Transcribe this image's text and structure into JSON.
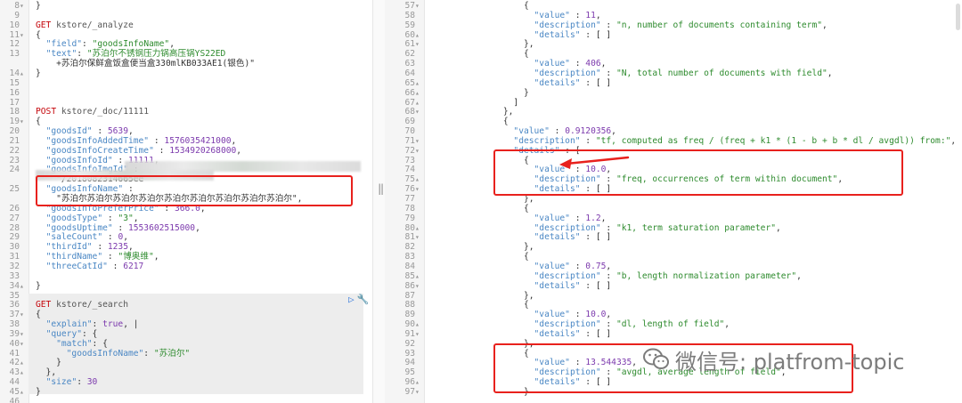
{
  "left_editor": {
    "lines": [
      {
        "n": "8",
        "fold": "▾",
        "text": "}"
      },
      {
        "n": "9",
        "fold": "",
        "text": ""
      },
      {
        "n": "10",
        "fold": "",
        "text": "GET kstore/_analyze"
      },
      {
        "n": "11",
        "fold": "▾",
        "text": "{"
      },
      {
        "n": "12",
        "fold": "",
        "text": "  \"field\": \"goodsInfoName\","
      },
      {
        "n": "13",
        "fold": "",
        "text": "  \"text\": \"苏泊尔不锈钢压力锅高压锅YS22ED"
      },
      {
        "n": "",
        "fold": "",
        "text": "    +苏泊尔保鲜盒饭盒便当盒330mlKB033AE1(银色)\""
      },
      {
        "n": "14",
        "fold": "▴",
        "text": "}"
      },
      {
        "n": "15",
        "fold": "",
        "text": ""
      },
      {
        "n": "16",
        "fold": "",
        "text": ""
      },
      {
        "n": "17",
        "fold": "",
        "text": ""
      },
      {
        "n": "18",
        "fold": "",
        "text": "POST kstore/_doc/11111"
      },
      {
        "n": "19",
        "fold": "▾",
        "text": "{"
      },
      {
        "n": "20",
        "fold": "",
        "text": "  \"goodsId\" : 5639,"
      },
      {
        "n": "21",
        "fold": "",
        "text": "  \"goodsInfoAddedTime\" : 1576035421000,"
      },
      {
        "n": "22",
        "fold": "",
        "text": "  \"goodsInfoCreateTime\" : 1534920268000,"
      },
      {
        "n": "23",
        "fold": "",
        "text": "  \"goodsInfoId\" : 11111,"
      },
      {
        "n": "24",
        "fold": "",
        "text": "  \"goodsInfoImgId\" :"
      },
      {
        "n": "",
        "fold": "",
        "text": "    \"/2018082314665ee"
      },
      {
        "n": "25",
        "fold": "",
        "text": "  \"goodsInfoName\" :"
      },
      {
        "n": "",
        "fold": "",
        "text": "    \"苏泊尔苏泊尔苏泊尔苏泊尔苏泊尔苏泊尔苏泊尔苏泊尔苏泊尔\","
      },
      {
        "n": "26",
        "fold": "",
        "text": "  \"goodsInfoPreferPrice\" : 366.0,"
      },
      {
        "n": "27",
        "fold": "",
        "text": "  \"goodsType\" : \"3\","
      },
      {
        "n": "28",
        "fold": "",
        "text": "  \"goodsUptime\" : 1553602515000,"
      },
      {
        "n": "29",
        "fold": "",
        "text": "  \"saleCount\" : 0,"
      },
      {
        "n": "30",
        "fold": "",
        "text": "  \"thirdId\" : 1235,"
      },
      {
        "n": "31",
        "fold": "",
        "text": "  \"thirdName\" : \"博奥维\","
      },
      {
        "n": "32",
        "fold": "",
        "text": "  \"threeCatId\" : 6217"
      },
      {
        "n": "33",
        "fold": "",
        "text": ""
      },
      {
        "n": "34",
        "fold": "▴",
        "text": "}"
      },
      {
        "n": "35",
        "fold": "",
        "text": ""
      },
      {
        "n": "36",
        "fold": "",
        "text": "GET kstore/_search"
      },
      {
        "n": "37",
        "fold": "▾",
        "text": "{"
      },
      {
        "n": "38",
        "fold": "",
        "text": "  \"explain\": true, |"
      },
      {
        "n": "39",
        "fold": "▾",
        "text": "  \"query\": {"
      },
      {
        "n": "40",
        "fold": "▾",
        "text": "    \"match\": {"
      },
      {
        "n": "41",
        "fold": "",
        "text": "      \"goodsInfoName\": \"苏泊尔\""
      },
      {
        "n": "42",
        "fold": "▴",
        "text": "    }"
      },
      {
        "n": "43",
        "fold": "▴",
        "text": "  },"
      },
      {
        "n": "44",
        "fold": "",
        "text": "  \"size\": 30"
      },
      {
        "n": "45",
        "fold": "▴",
        "text": "}"
      },
      {
        "n": "46",
        "fold": "",
        "text": ""
      }
    ]
  },
  "right_editor": {
    "lines": [
      {
        "n": "57",
        "fold": "▾",
        "text": "                  {"
      },
      {
        "n": "58",
        "fold": "",
        "text": "                    \"value\" : 11,"
      },
      {
        "n": "59",
        "fold": "",
        "text": "                    \"description\" : \"n, number of documents containing term\","
      },
      {
        "n": "60",
        "fold": "▴",
        "text": "                    \"details\" : [ ]"
      },
      {
        "n": "61",
        "fold": "▾",
        "text": "                  },"
      },
      {
        "n": "62",
        "fold": "",
        "text": "                  {"
      },
      {
        "n": "63",
        "fold": "",
        "text": "                    \"value\" : 406,"
      },
      {
        "n": "64",
        "fold": "",
        "text": "                    \"description\" : \"N, total number of documents with field\","
      },
      {
        "n": "65",
        "fold": "▴",
        "text": "                    \"details\" : [ ]"
      },
      {
        "n": "66",
        "fold": "▴",
        "text": "                  }"
      },
      {
        "n": "67",
        "fold": "▴",
        "text": "                ]"
      },
      {
        "n": "68",
        "fold": "▾",
        "text": "              },"
      },
      {
        "n": "69",
        "fold": "",
        "text": "              {"
      },
      {
        "n": "70",
        "fold": "",
        "text": "                \"value\" : 0.9120356,"
      },
      {
        "n": "71",
        "fold": "▾",
        "text": "                \"description\" : \"tf, computed as freq / (freq + k1 * (1 - b + b * dl / avgdl)) from:\","
      },
      {
        "n": "72",
        "fold": "▾",
        "text": "                \"details\" : ["
      },
      {
        "n": "73",
        "fold": "",
        "text": "                  {"
      },
      {
        "n": "74",
        "fold": "",
        "text": "                    \"value\" : 10.0,"
      },
      {
        "n": "75",
        "fold": "▴",
        "text": "                    \"description\" : \"freq, occurrences of term within document\","
      },
      {
        "n": "76",
        "fold": "▾",
        "text": "                    \"details\" : [ ]"
      },
      {
        "n": "77",
        "fold": "",
        "text": "                  },"
      },
      {
        "n": "78",
        "fold": "",
        "text": "                  {"
      },
      {
        "n": "79",
        "fold": "",
        "text": "                    \"value\" : 1.2,"
      },
      {
        "n": "80",
        "fold": "▴",
        "text": "                    \"description\" : \"k1, term saturation parameter\","
      },
      {
        "n": "81",
        "fold": "▾",
        "text": "                    \"details\" : [ ]"
      },
      {
        "n": "82",
        "fold": "",
        "text": "                  },"
      },
      {
        "n": "83",
        "fold": "",
        "text": "                  {"
      },
      {
        "n": "84",
        "fold": "",
        "text": "                    \"value\" : 0.75,"
      },
      {
        "n": "85",
        "fold": "▴",
        "text": "                    \"description\" : \"b, length normalization parameter\","
      },
      {
        "n": "86",
        "fold": "▾",
        "text": "                    \"details\" : [ ]"
      },
      {
        "n": "87",
        "fold": "",
        "text": "                  },"
      },
      {
        "n": "88",
        "fold": "",
        "text": "                  {"
      },
      {
        "n": "89",
        "fold": "",
        "text": "                    \"value\" : 10.0,"
      },
      {
        "n": "90",
        "fold": "▴",
        "text": "                    \"description\" : \"dl, length of field\","
      },
      {
        "n": "91",
        "fold": "▾",
        "text": "                    \"details\" : [ ]"
      },
      {
        "n": "92",
        "fold": "",
        "text": "                  },"
      },
      {
        "n": "93",
        "fold": "",
        "text": "                  {"
      },
      {
        "n": "94",
        "fold": "",
        "text": "                    \"value\" : 13.544335,"
      },
      {
        "n": "95",
        "fold": "",
        "text": "                    \"description\" : \"avgdl, average length of field\","
      },
      {
        "n": "96",
        "fold": "▴",
        "text": "                    \"details\" : [ ]"
      },
      {
        "n": "97",
        "fold": "▾",
        "text": "                  }"
      }
    ]
  },
  "watermark": {
    "label": "微信号: platfrom-topic",
    "icon": "wechat-icon"
  },
  "toolbar": {
    "run_icon": "play-icon",
    "settings_icon": "wrench-icon"
  },
  "colors": {
    "highlight_box": "#e8211d",
    "method": "#c5060b",
    "key": "#4a87c4",
    "string": "#2e8b2e",
    "number": "#7c3aad"
  }
}
